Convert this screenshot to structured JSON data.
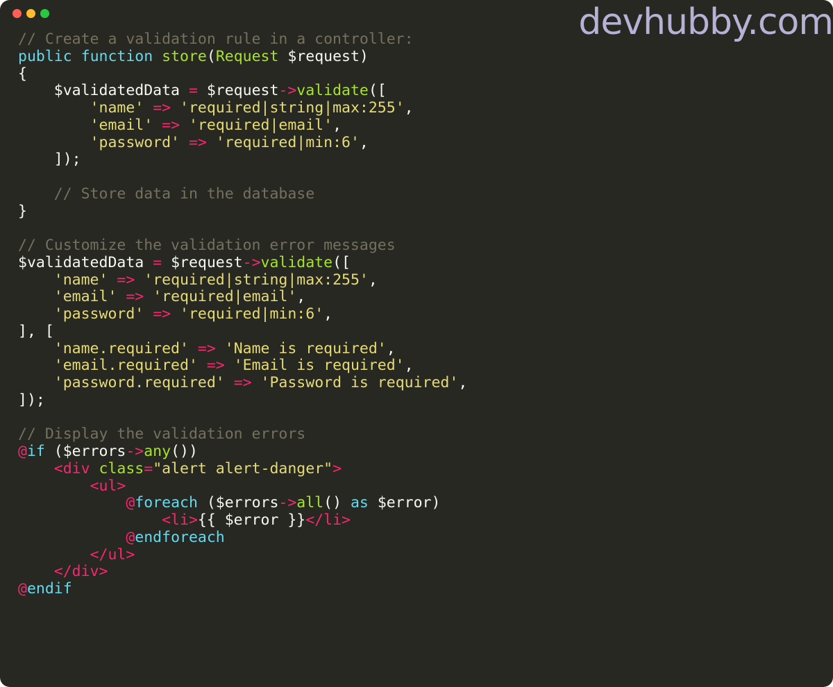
{
  "window": {
    "controls": [
      {
        "name": "close",
        "color": "#ff5f57"
      },
      {
        "name": "minimize",
        "color": "#febc2e"
      },
      {
        "name": "maximize",
        "color": "#28c840"
      }
    ]
  },
  "watermark": "devhubby.com",
  "theme": {
    "background": "#272822",
    "plain": "#f8f8f2",
    "comment": "#75715e",
    "keyword": "#66d9ef",
    "function": "#a6e22e",
    "string": "#e6db74",
    "operator": "#f92672"
  },
  "code_lines": [
    [
      [
        "comment",
        "// Create a validation rule in a controller:"
      ]
    ],
    [
      [
        "keyword",
        "public"
      ],
      [
        "plain",
        " "
      ],
      [
        "keyword",
        "function"
      ],
      [
        "plain",
        " "
      ],
      [
        "function",
        "store"
      ],
      [
        "plain",
        "("
      ],
      [
        "function",
        "Request"
      ],
      [
        "plain",
        " $request)"
      ]
    ],
    [
      [
        "plain",
        "{"
      ]
    ],
    [
      [
        "plain",
        "    $validatedData "
      ],
      [
        "operator",
        "="
      ],
      [
        "plain",
        " $request"
      ],
      [
        "operator",
        "->"
      ],
      [
        "function",
        "validate"
      ],
      [
        "plain",
        "(["
      ]
    ],
    [
      [
        "plain",
        "        "
      ],
      [
        "string",
        "'name'"
      ],
      [
        "plain",
        " "
      ],
      [
        "operator",
        "=>"
      ],
      [
        "plain",
        " "
      ],
      [
        "string",
        "'required|string|max:255'"
      ],
      [
        "plain",
        ","
      ]
    ],
    [
      [
        "plain",
        "        "
      ],
      [
        "string",
        "'email'"
      ],
      [
        "plain",
        " "
      ],
      [
        "operator",
        "=>"
      ],
      [
        "plain",
        " "
      ],
      [
        "string",
        "'required|email'"
      ],
      [
        "plain",
        ","
      ]
    ],
    [
      [
        "plain",
        "        "
      ],
      [
        "string",
        "'password'"
      ],
      [
        "plain",
        " "
      ],
      [
        "operator",
        "=>"
      ],
      [
        "plain",
        " "
      ],
      [
        "string",
        "'required|min:6'"
      ],
      [
        "plain",
        ","
      ]
    ],
    [
      [
        "plain",
        "    ]);"
      ]
    ],
    [],
    [
      [
        "plain",
        "    "
      ],
      [
        "comment",
        "// Store data in the database"
      ]
    ],
    [
      [
        "plain",
        "}"
      ]
    ],
    [],
    [
      [
        "comment",
        "// Customize the validation error messages"
      ]
    ],
    [
      [
        "plain",
        "$validatedData "
      ],
      [
        "operator",
        "="
      ],
      [
        "plain",
        " $request"
      ],
      [
        "operator",
        "->"
      ],
      [
        "function",
        "validate"
      ],
      [
        "plain",
        "(["
      ]
    ],
    [
      [
        "plain",
        "    "
      ],
      [
        "string",
        "'name'"
      ],
      [
        "plain",
        " "
      ],
      [
        "operator",
        "=>"
      ],
      [
        "plain",
        " "
      ],
      [
        "string",
        "'required|string|max:255'"
      ],
      [
        "plain",
        ","
      ]
    ],
    [
      [
        "plain",
        "    "
      ],
      [
        "string",
        "'email'"
      ],
      [
        "plain",
        " "
      ],
      [
        "operator",
        "=>"
      ],
      [
        "plain",
        " "
      ],
      [
        "string",
        "'required|email'"
      ],
      [
        "plain",
        ","
      ]
    ],
    [
      [
        "plain",
        "    "
      ],
      [
        "string",
        "'password'"
      ],
      [
        "plain",
        " "
      ],
      [
        "operator",
        "=>"
      ],
      [
        "plain",
        " "
      ],
      [
        "string",
        "'required|min:6'"
      ],
      [
        "plain",
        ","
      ]
    ],
    [
      [
        "plain",
        "], ["
      ]
    ],
    [
      [
        "plain",
        "    "
      ],
      [
        "string",
        "'name.required'"
      ],
      [
        "plain",
        " "
      ],
      [
        "operator",
        "=>"
      ],
      [
        "plain",
        " "
      ],
      [
        "string",
        "'Name is required'"
      ],
      [
        "plain",
        ","
      ]
    ],
    [
      [
        "plain",
        "    "
      ],
      [
        "string",
        "'email.required'"
      ],
      [
        "plain",
        " "
      ],
      [
        "operator",
        "=>"
      ],
      [
        "plain",
        " "
      ],
      [
        "string",
        "'Email is required'"
      ],
      [
        "plain",
        ","
      ]
    ],
    [
      [
        "plain",
        "    "
      ],
      [
        "string",
        "'password.required'"
      ],
      [
        "plain",
        " "
      ],
      [
        "operator",
        "=>"
      ],
      [
        "plain",
        " "
      ],
      [
        "string",
        "'Password is required'"
      ],
      [
        "plain",
        ","
      ]
    ],
    [
      [
        "plain",
        "]);"
      ]
    ],
    [],
    [
      [
        "comment",
        "// Display the validation errors"
      ]
    ],
    [
      [
        "operator",
        "@"
      ],
      [
        "keyword",
        "if"
      ],
      [
        "plain",
        " ($errors"
      ],
      [
        "operator",
        "->"
      ],
      [
        "function",
        "any"
      ],
      [
        "plain",
        "())"
      ]
    ],
    [
      [
        "plain",
        "    "
      ],
      [
        "operator",
        "<div"
      ],
      [
        "plain",
        " "
      ],
      [
        "function",
        "class"
      ],
      [
        "operator",
        "="
      ],
      [
        "string",
        "\"alert alert-danger\""
      ],
      [
        "operator",
        ">"
      ]
    ],
    [
      [
        "plain",
        "        "
      ],
      [
        "operator",
        "<ul>"
      ]
    ],
    [
      [
        "plain",
        "            "
      ],
      [
        "operator",
        "@"
      ],
      [
        "keyword",
        "foreach"
      ],
      [
        "plain",
        " ($errors"
      ],
      [
        "operator",
        "->"
      ],
      [
        "function",
        "all"
      ],
      [
        "plain",
        "() "
      ],
      [
        "keyword",
        "as"
      ],
      [
        "plain",
        " $error)"
      ]
    ],
    [
      [
        "plain",
        "                "
      ],
      [
        "operator",
        "<li>"
      ],
      [
        "plain",
        "{{ $error }}"
      ],
      [
        "operator",
        "</li>"
      ]
    ],
    [
      [
        "plain",
        "            "
      ],
      [
        "operator",
        "@"
      ],
      [
        "keyword",
        "endforeach"
      ]
    ],
    [
      [
        "plain",
        "        "
      ],
      [
        "operator",
        "</ul>"
      ]
    ],
    [
      [
        "plain",
        "    "
      ],
      [
        "operator",
        "</div>"
      ]
    ],
    [
      [
        "operator",
        "@"
      ],
      [
        "keyword",
        "endif"
      ]
    ]
  ]
}
